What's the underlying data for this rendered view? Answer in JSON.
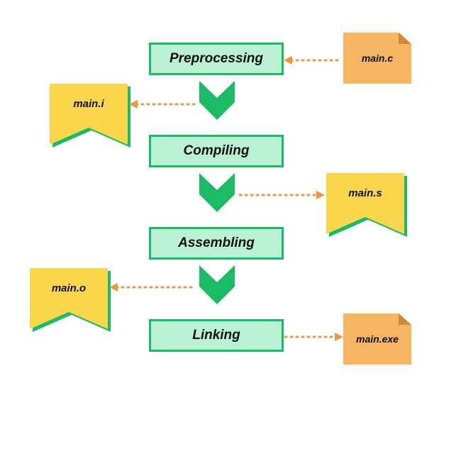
{
  "stages": {
    "preprocessing": "Preprocessing",
    "compiling": "Compiling",
    "assembling": "Assembling",
    "linking": "Linking"
  },
  "files": {
    "input": "main.c",
    "preprocessed": "main.i",
    "assembly": "main.s",
    "object": "main.o",
    "output": "main.exe"
  },
  "colors": {
    "accent_green": "#19bb65",
    "box_fill": "#baf0d4",
    "ribbon_yellow": "#f9d64c",
    "doc_orange": "#f5b562",
    "arrow_orange": "#f2953d"
  }
}
